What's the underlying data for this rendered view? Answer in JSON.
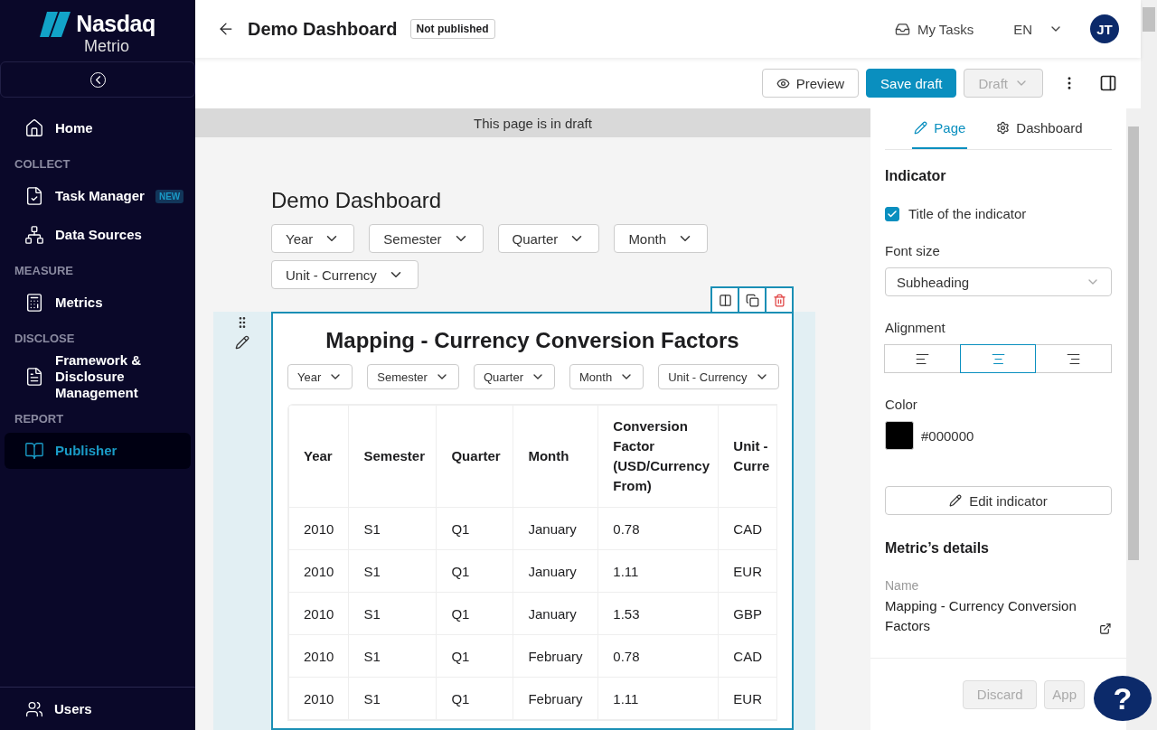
{
  "sidebar": {
    "logo": {
      "brand": "Nasdaq",
      "product": "Metrio"
    },
    "items": [
      {
        "kind": "link",
        "label": "Home",
        "selected": false
      },
      {
        "kind": "section",
        "label": "COLLECT"
      },
      {
        "kind": "link",
        "label": "Task Manager",
        "badge": "NEW",
        "selected": false
      },
      {
        "kind": "link",
        "label": "Data Sources",
        "selected": false
      },
      {
        "kind": "section",
        "label": "MEASURE"
      },
      {
        "kind": "link",
        "label": "Metrics",
        "selected": false
      },
      {
        "kind": "section",
        "label": "DISCLOSE"
      },
      {
        "kind": "link",
        "label": "Framework & Disclosure Management",
        "selected": false
      },
      {
        "kind": "section",
        "label": "REPORT"
      },
      {
        "kind": "link",
        "label": "Publisher",
        "selected": true
      }
    ],
    "footer": {
      "label": "Users"
    }
  },
  "header": {
    "title": "Demo Dashboard",
    "status": "Not published",
    "my_tasks": "My Tasks",
    "language": "EN",
    "avatar": "JT"
  },
  "toolbar": {
    "preview": "Preview",
    "save": "Save draft",
    "state": {
      "label": "Draft",
      "disabled": true
    }
  },
  "banner": "This page is in draft",
  "dashboard": {
    "title": "Demo Dashboard",
    "filters": [
      "Year",
      "Semester",
      "Quarter",
      "Month",
      "Unit - Currency"
    ],
    "widget": {
      "title": "Mapping - Currency Conversion Factors",
      "filters": [
        "Year",
        "Semester",
        "Quarter",
        "Month",
        "Unit - Currency"
      ],
      "table": {
        "columns": [
          "Year",
          "Semester",
          "Quarter",
          "Month",
          "Conversion Factor (USD/Currency From)",
          "Unit - Curre"
        ],
        "rows": [
          [
            "2010",
            "S1",
            "Q1",
            "January",
            "0.78",
            "CAD"
          ],
          [
            "2010",
            "S1",
            "Q1",
            "January",
            "1.11",
            "EUR"
          ],
          [
            "2010",
            "S1",
            "Q1",
            "January",
            "1.53",
            "GBP"
          ],
          [
            "2010",
            "S1",
            "Q1",
            "February",
            "0.78",
            "CAD"
          ],
          [
            "2010",
            "S1",
            "Q1",
            "February",
            "1.11",
            "EUR"
          ]
        ]
      }
    }
  },
  "panel": {
    "tabs": [
      {
        "label": "Page",
        "selected": true
      },
      {
        "label": "Dashboard",
        "selected": false
      }
    ],
    "heading": "Indicator",
    "show_title": {
      "label": "Title of the indicator",
      "checked": true
    },
    "font_size": {
      "label": "Font size",
      "value": "Subheading"
    },
    "alignment": {
      "label": "Alignment",
      "options": [
        {
          "selected": false
        },
        {
          "selected": true
        },
        {
          "selected": false
        }
      ]
    },
    "color": {
      "label": "Color",
      "value": "#000000"
    },
    "edit": "Edit indicator",
    "details_heading": "Metric’s details",
    "name": {
      "label": "Name",
      "value": "Mapping - Currency Conversion Factors"
    },
    "footer": {
      "discard": {
        "label": "Discard",
        "disabled": true
      },
      "apply": {
        "label": "App",
        "disabled": true
      }
    },
    "help": "?"
  }
}
